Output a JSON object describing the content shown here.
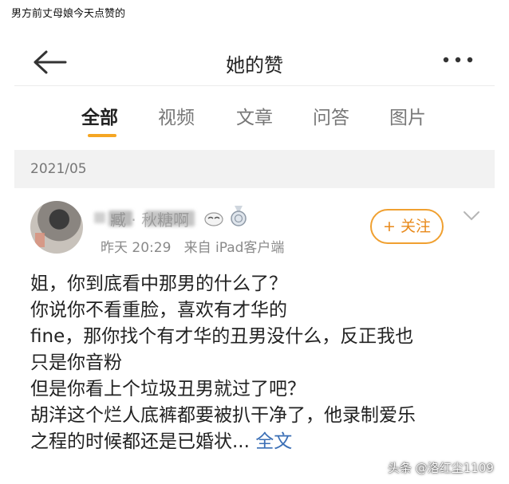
{
  "caption": "男方前丈母娘今天点赞的",
  "navbar": {
    "title": "她的赞",
    "back_icon": "back-arrow-icon",
    "more_icon": "more-dots-icon"
  },
  "tabs": [
    {
      "label": "全部",
      "active": true
    },
    {
      "label": "视频",
      "active": false
    },
    {
      "label": "文章",
      "active": false
    },
    {
      "label": "问答",
      "active": false
    },
    {
      "label": "图片",
      "active": false
    }
  ],
  "accent_color": "#f5a623",
  "date_header": "2021/05",
  "post": {
    "username_visible": "臧 · 秋糖啊",
    "meta": "昨天 20:29   来自 iPad客户端",
    "follow_label": "+ 关注",
    "text_lines": [
      "姐，你到底看中那男的什么了？",
      "你说你不看重脸，喜欢有才华的",
      "fine，那你找个有才华的丑男没什么，反正我也",
      "只是你音粉",
      "但是你看上个垃圾丑男就过了吧？",
      "胡洋这个烂人底裤都要被扒干净了，他录制爱乐",
      "之程的时候都还是已婚状..."
    ],
    "full_text_link": "全文"
  },
  "watermark": "头条 @洛红尘1109"
}
